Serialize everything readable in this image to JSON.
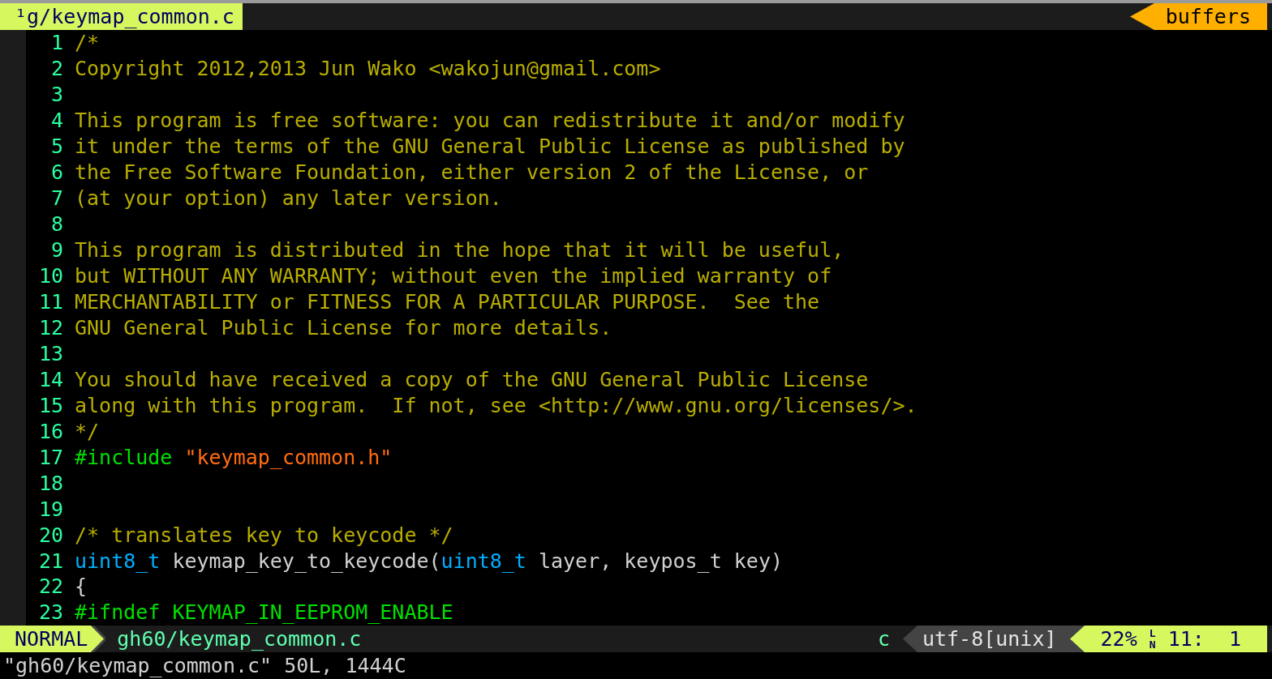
{
  "tabline": {
    "tabs": [
      {
        "label": "¹g/keymap_common.c",
        "selected": true
      }
    ],
    "right_label": "buffers"
  },
  "lines": [
    {
      "number": "1",
      "segments": [
        {
          "kind": "comment",
          "text": "/*"
        }
      ]
    },
    {
      "number": "2",
      "segments": [
        {
          "kind": "comment",
          "text": "Copyright 2012,2013 Jun Wako <wakojun@gmail.com>"
        }
      ]
    },
    {
      "number": "3"
    },
    {
      "number": "4",
      "segments": [
        {
          "kind": "comment",
          "text": "This program is free software: you can redistribute it and/or modify"
        }
      ]
    },
    {
      "number": "5",
      "segments": [
        {
          "kind": "comment",
          "text": "it under the terms of the GNU General Public License as published by"
        }
      ]
    },
    {
      "number": "6",
      "segments": [
        {
          "kind": "comment",
          "text": "the Free Software Foundation, either version 2 of the License, or"
        }
      ]
    },
    {
      "number": "7",
      "segments": [
        {
          "kind": "comment",
          "text": "(at your option) any later version."
        }
      ]
    },
    {
      "number": "8"
    },
    {
      "number": "9",
      "segments": [
        {
          "kind": "comment",
          "text": "This program is distributed in the hope that it will be useful,"
        }
      ]
    },
    {
      "number": "10",
      "segments": [
        {
          "kind": "comment",
          "text": "but WITHOUT ANY WARRANTY; without even the implied warranty of"
        }
      ]
    },
    {
      "number": "11",
      "segments": [
        {
          "kind": "comment",
          "text": "MERCHANTABILITY or FITNESS FOR A PARTICULAR PURPOSE.  See the"
        }
      ]
    },
    {
      "number": "12",
      "segments": [
        {
          "kind": "comment",
          "text": "GNU General Public License for more details."
        }
      ]
    },
    {
      "number": "13"
    },
    {
      "number": "14",
      "segments": [
        {
          "kind": "comment",
          "text": "You should have received a copy of the GNU General Public License"
        }
      ]
    },
    {
      "number": "15",
      "segments": [
        {
          "kind": "comment",
          "text": "along with this program.  If not, see <http://www.gnu.org/licenses/>."
        }
      ]
    },
    {
      "number": "16",
      "segments": [
        {
          "kind": "comment",
          "text": "*/"
        }
      ]
    },
    {
      "number": "17",
      "segments": [
        {
          "kind": "preproc",
          "text": "#include "
        },
        {
          "kind": "string",
          "text": "\"keymap_common.h\""
        }
      ]
    },
    {
      "number": "18"
    },
    {
      "number": "19"
    },
    {
      "number": "20",
      "segments": [
        {
          "kind": "comment",
          "text": "/* translates key to keycode */"
        }
      ]
    },
    {
      "number": "21",
      "segments": [
        {
          "kind": "type",
          "text": "uint8_t"
        },
        {
          "kind": "plain",
          "text": " keymap_key_to_keycode("
        },
        {
          "kind": "type",
          "text": "uint8_t"
        },
        {
          "kind": "plain",
          "text": " layer, keypos_t key)"
        }
      ]
    },
    {
      "number": "22",
      "segments": [
        {
          "kind": "plain",
          "text": "{"
        }
      ]
    },
    {
      "number": "23",
      "segments": [
        {
          "kind": "preproc",
          "text": "#ifndef KEYMAP_IN_EEPROM_ENABLE"
        }
      ]
    }
  ],
  "statusline": {
    "mode": "NORMAL",
    "file": "gh60/keymap_common.c",
    "filetype": "c",
    "encoding": "utf-8[unix]",
    "percent": "22%",
    "line_symbol": "LN",
    "position": "11:  1"
  },
  "command_line": "\"gh60/keymap_common.c\" 50L, 1444C"
}
